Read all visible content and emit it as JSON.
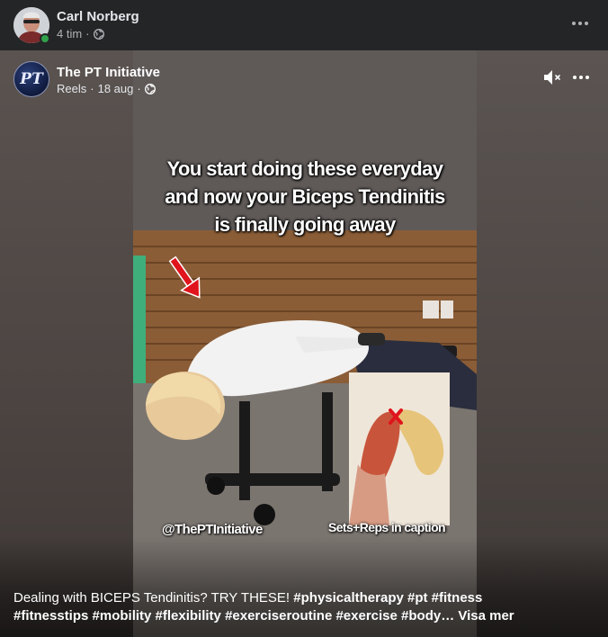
{
  "post": {
    "author": "Carl Norberg",
    "time": "4 tim",
    "separator": "·",
    "privacy_icon": "globe-icon",
    "online": true
  },
  "reel": {
    "page_name": "The PT Initiative",
    "page_avatar_text": "PT",
    "type_label": "Reels",
    "date": "18 aug",
    "separator": "·",
    "privacy_icon": "globe-icon",
    "mute_icon": "speaker-muted-icon",
    "headline_lines": [
      "You start doing these everyday",
      "and now your Biceps Tendinitis",
      "is finally going away"
    ],
    "handle": "@ThePTInitiative",
    "sets_text": "Sets+Reps in caption"
  },
  "caption": {
    "intro": "Dealing with BICEPS Tendinitis? TRY THESE!",
    "tags_line1": "#physicaltherapy #pt #fitness",
    "tags_line2": "#fitnesstips #mobility #flexibility #exerciseroutine #exercise #body…",
    "see_more": "Visa mer"
  },
  "colors": {
    "background": "#242526",
    "online": "#31a24c",
    "secondary_text": "#b0b3b8"
  }
}
